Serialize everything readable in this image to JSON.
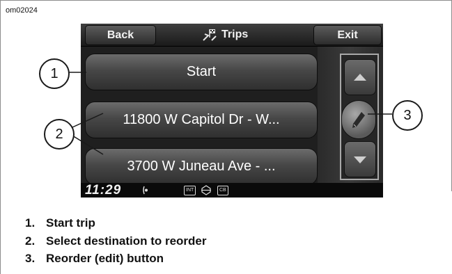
{
  "figure_id": "om02024",
  "header": {
    "back_label": "Back",
    "title": "Trips",
    "title_icon": "trip-flag-icon",
    "exit_label": "Exit"
  },
  "list": {
    "rows": [
      {
        "label": "Start"
      },
      {
        "label": "11800 W Capitol Dr - W..."
      },
      {
        "label": "3700 W Juneau Ave - ..."
      }
    ]
  },
  "side_controls": {
    "up_icon": "arrow-up-icon",
    "edit_icon": "pencil-icon",
    "down_icon": "arrow-down-icon"
  },
  "status_bar": {
    "time": "11:29",
    "badge_int": "INT",
    "badge_cb": "CB"
  },
  "callouts": {
    "c1": "1",
    "c2": "2",
    "c3": "3"
  },
  "captions": [
    {
      "num": "1.",
      "text": "Start trip"
    },
    {
      "num": "2.",
      "text": "Select destination to reorder"
    },
    {
      "num": "3.",
      "text": "Reorder (edit) button"
    }
  ]
}
